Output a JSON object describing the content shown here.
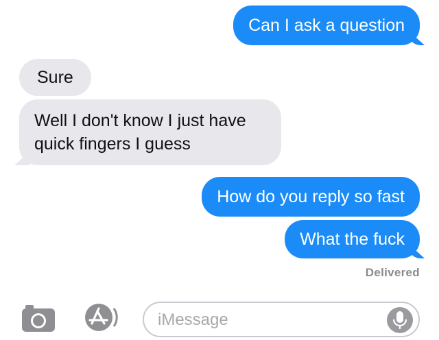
{
  "conversation": {
    "messages": [
      {
        "text": "Can I ask a question",
        "direction": "sent"
      },
      {
        "text": "Sure",
        "direction": "received"
      },
      {
        "text": "Well I don't know I just have quick fingers I guess",
        "direction": "received"
      },
      {
        "text": "How do you reply so fast",
        "direction": "sent"
      },
      {
        "text": "What the fuck",
        "direction": "sent"
      }
    ],
    "status": "Delivered"
  },
  "composer": {
    "placeholder": "iMessage",
    "value": "",
    "camera_icon": "camera-icon",
    "apps_icon": "app-store-icon",
    "mic_icon": "microphone-icon"
  },
  "colors": {
    "sent_bubble": "#1b8cf7",
    "received_bubble": "#e7e7ec",
    "status_text": "#8a8a8f"
  }
}
